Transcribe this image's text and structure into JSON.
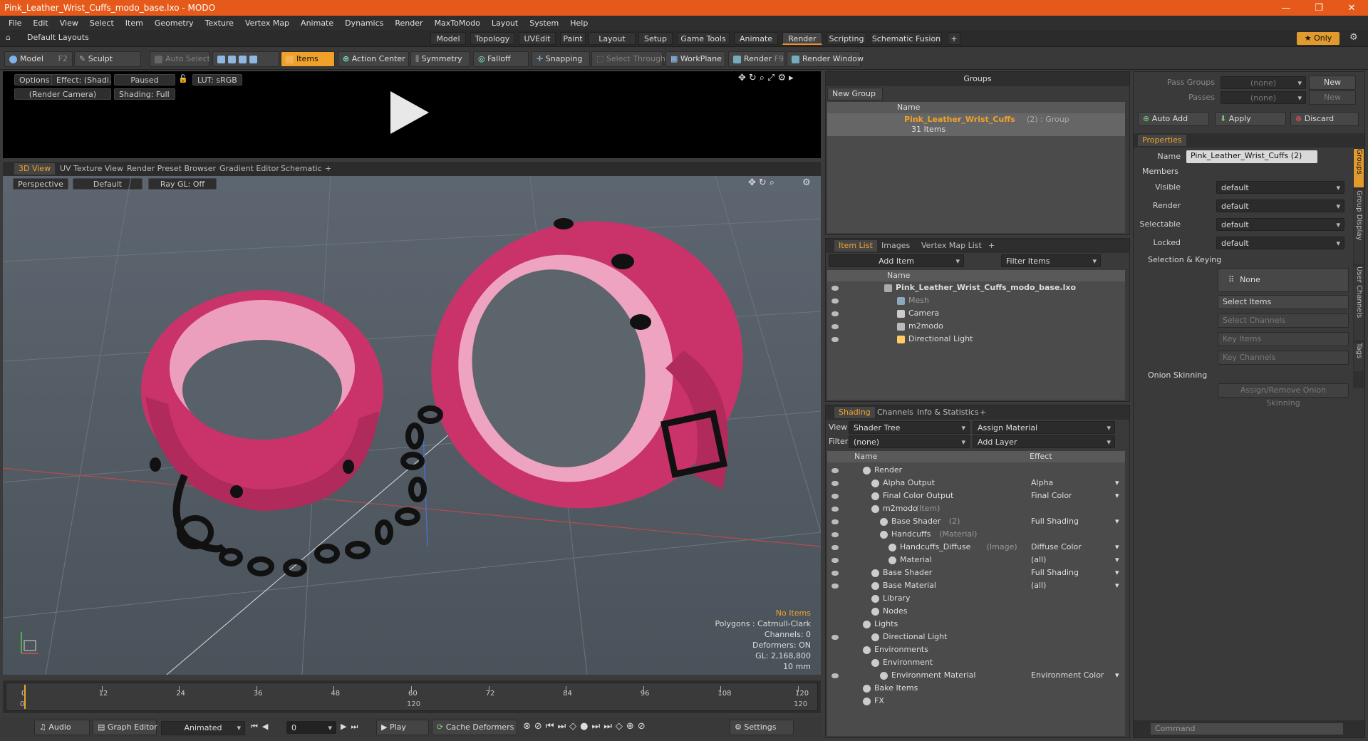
{
  "window": {
    "title": "Pink_Leather_Wrist_Cuffs_modo_base.lxo - MODO",
    "controls": [
      "—",
      "❐",
      "✕"
    ]
  },
  "menu": [
    "File",
    "Edit",
    "View",
    "Select",
    "Item",
    "Geometry",
    "Texture",
    "Vertex Map",
    "Animate",
    "Dynamics",
    "Render",
    "MaxToModo",
    "Layout",
    "System",
    "Help"
  ],
  "layoutbar": {
    "layouts": "Default Layouts",
    "tabs": [
      "Model",
      "Topology",
      "UVEdit",
      "Paint",
      "Layout",
      "Setup",
      "Game Tools",
      "Animate",
      "Render",
      "Scripting",
      "Schematic Fusion",
      "+"
    ],
    "active": "Render",
    "only": "★ Only"
  },
  "toolbar": {
    "model": "Model",
    "model_key": "F2",
    "sculpt": "Sculpt",
    "auto_select": "Auto Select",
    "items": "Items",
    "action_center": "Action Center",
    "symmetry": "Symmetry",
    "falloff": "Falloff",
    "snapping": "Snapping",
    "select_through": "Select Through",
    "workplane": "WorkPlane",
    "render": "Render",
    "render_key": "F9",
    "render_window": "Render Window"
  },
  "preview": {
    "options": "Options",
    "effect": "Effect: (Shadi...",
    "paused": "Paused",
    "lut": "LUT: sRGB",
    "camera": "(Render Camera)",
    "shading": "Shading: Full"
  },
  "viewport_tabs": [
    "3D View",
    "UV Texture View",
    "Render Preset Browser",
    "Gradient Editor",
    "Schematic",
    "+"
  ],
  "viewport": {
    "perspective": "Perspective",
    "default": "Default",
    "raygl": "Ray GL: Off",
    "info": {
      "no_items": "No Items",
      "polygons": "Polygons : Catmull-Clark",
      "channels": "Channels: 0",
      "deformers": "Deformers: ON",
      "gl": "GL: 2,168,800",
      "scale": "10 mm"
    }
  },
  "timeline": {
    "ticks": [
      "0",
      "12",
      "24",
      "36",
      "48",
      "60",
      "72",
      "84",
      "96",
      "108",
      "120"
    ],
    "lower": [
      "0",
      "",
      "",
      "",
      "",
      "120",
      "",
      "",
      "",
      "",
      "120"
    ]
  },
  "bottom": {
    "audio": "Audio",
    "graph_editor": "Graph Editor",
    "animated": "Animated",
    "frame": "0",
    "play": "Play",
    "cache": "Cache Deformers",
    "settings": "Settings"
  },
  "groups": {
    "title": "Groups",
    "new_group": "New Group",
    "col_name": "Name",
    "item_name": "Pink_Leather_Wrist_Cuffs",
    "item_count": "(2) : Group",
    "item_sub": "31 Items"
  },
  "itemlist": {
    "tabs": [
      "Item List",
      "Images",
      "Vertex Map List",
      "+"
    ],
    "add_item": "Add Item",
    "filter": "Filter Items",
    "col_name": "Name",
    "items": [
      {
        "name": "Pink_Leather_Wrist_Cuffs_modo_base.lxo",
        "icon": "scene-icon"
      },
      {
        "name": "Mesh",
        "icon": "mesh-icon"
      },
      {
        "name": "Camera",
        "icon": "camera-icon"
      },
      {
        "name": "m2modo",
        "icon": "group-icon"
      },
      {
        "name": "Directional Light",
        "icon": "light-icon"
      }
    ]
  },
  "shading": {
    "tabs": [
      "Shading",
      "Channels",
      "Info & Statistics",
      "+"
    ],
    "view_label": "View",
    "view_value": "Shader Tree",
    "assign": "Assign Material",
    "filter_label": "Filter",
    "filter_value": "(none)",
    "add_layer": "Add Layer",
    "col_name": "Name",
    "col_effect": "Effect",
    "rows": [
      {
        "name": "Render",
        "sub": "",
        "effect": "",
        "ind": 0
      },
      {
        "name": "Alpha Output",
        "sub": "",
        "effect": "Alpha",
        "ind": 1
      },
      {
        "name": "Final Color Output",
        "sub": "",
        "effect": "Final Color",
        "ind": 1
      },
      {
        "name": "m2modo",
        "sub": "(Item)",
        "effect": "",
        "ind": 1
      },
      {
        "name": "Base Shader",
        "sub": "(2)",
        "effect": "Full Shading",
        "ind": 2
      },
      {
        "name": "Handcuffs",
        "sub": "(Material)",
        "effect": "",
        "ind": 2
      },
      {
        "name": "Handcuffs_Diffuse",
        "sub": "(Image)",
        "effect": "Diffuse Color",
        "ind": 3
      },
      {
        "name": "Material",
        "sub": "",
        "effect": "(all)",
        "ind": 3
      },
      {
        "name": "Base Shader",
        "sub": "",
        "effect": "Full Shading",
        "ind": 1
      },
      {
        "name": "Base Material",
        "sub": "",
        "effect": "(all)",
        "ind": 1
      },
      {
        "name": "Library",
        "sub": "",
        "effect": "",
        "ind": 1
      },
      {
        "name": "Nodes",
        "sub": "",
        "effect": "",
        "ind": 1
      },
      {
        "name": "Lights",
        "sub": "",
        "effect": "",
        "ind": 0
      },
      {
        "name": "Directional Light",
        "sub": "",
        "effect": "",
        "ind": 1
      },
      {
        "name": "Environments",
        "sub": "",
        "effect": "",
        "ind": 0
      },
      {
        "name": "Environment",
        "sub": "",
        "effect": "",
        "ind": 1
      },
      {
        "name": "Environment Material",
        "sub": "",
        "effect": "Environment Color",
        "ind": 2
      },
      {
        "name": "Bake Items",
        "sub": "",
        "effect": "",
        "ind": 0
      },
      {
        "name": "FX",
        "sub": "",
        "effect": "",
        "ind": 0
      }
    ]
  },
  "props": {
    "pass_groups": "Pass Groups",
    "passes": "Passes",
    "none": "(none)",
    "new": "New",
    "auto_add": "Auto Add",
    "apply": "Apply",
    "discard": "Discard",
    "tab": "Properties",
    "name_label": "Name",
    "name_value": "Pink_Leather_Wrist_Cuffs (2)",
    "members": "Members",
    "visible": "Visible",
    "render": "Render",
    "selectable": "Selectable",
    "locked": "Locked",
    "default": "default",
    "sel_keying": "Selection & Keying",
    "none_btn": "None",
    "select_items": "Select Items",
    "select_channels": "Select Channels",
    "key_items": "Key Items",
    "key_channels": "Key Channels",
    "onion": "Onion Skinning",
    "assign_onion": "Assign/Remove Onion Skinning",
    "side_tabs": [
      "Groups",
      "Group Display",
      "User Channels",
      "Tags"
    ],
    "command": "Command"
  },
  "colors": {
    "accent": "#f0a22a",
    "title": "#e55a1a",
    "cuff": "#d83a6e",
    "cuff_inner": "#f1b6cc",
    "group_name": "#f0a22a"
  }
}
